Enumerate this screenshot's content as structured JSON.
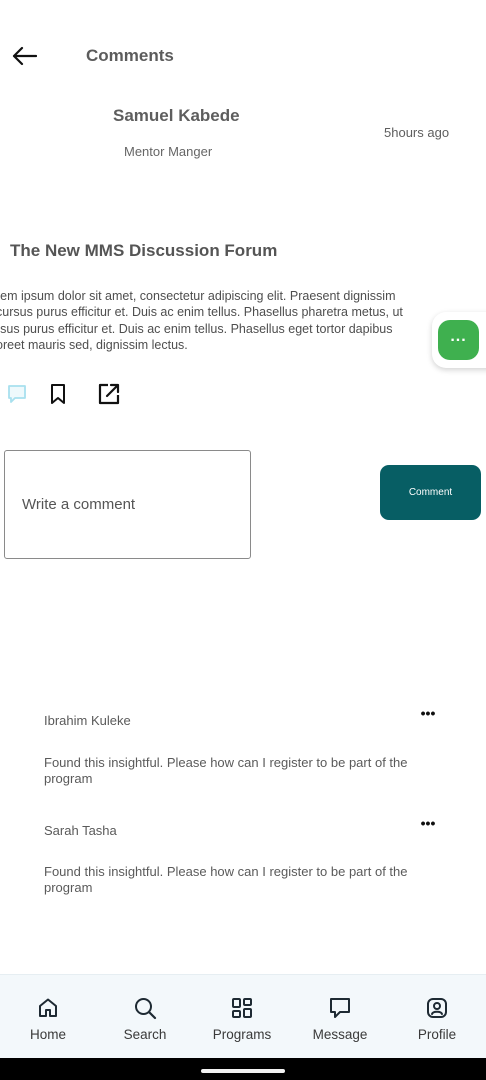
{
  "header": {
    "title": "Comments"
  },
  "author": {
    "name": "Samuel Kabede",
    "role": "Mentor Manger",
    "time": "5hours ago"
  },
  "post": {
    "title": "The New MMS Discussion Forum",
    "lines": [
      "rem ipsum dolor sit amet, consectetur adipiscing elit. Praesent dignissim",
      "cursus purus efficitur et. Duis ac enim tellus. Phasellus pharetra metus, ut",
      "rsus purus efficitur et. Duis ac enim tellus. Phasellus eget tortor dapibus",
      "oreet mauris sed, dignissim lectus."
    ]
  },
  "comment_form": {
    "placeholder": "Write a comment",
    "button_label": "Comment"
  },
  "comments": [
    {
      "author": "Ibrahim Kuleke",
      "text": "Found this insightful. Please how can I register to be part of the program"
    },
    {
      "author": "Sarah Tasha",
      "text": "Found this insightful. Please how can I register to be part of the program"
    }
  ],
  "nav": [
    {
      "label": "Home",
      "icon": "home-icon"
    },
    {
      "label": "Search",
      "icon": "search-icon"
    },
    {
      "label": "Programs",
      "icon": "grid-icon"
    },
    {
      "label": "Message",
      "icon": "message-icon"
    },
    {
      "label": "Profile",
      "icon": "profile-icon"
    }
  ],
  "colors": {
    "accent": "#075e64",
    "fab": "#3fb04f",
    "nav_bg": "#f3f8fb"
  }
}
